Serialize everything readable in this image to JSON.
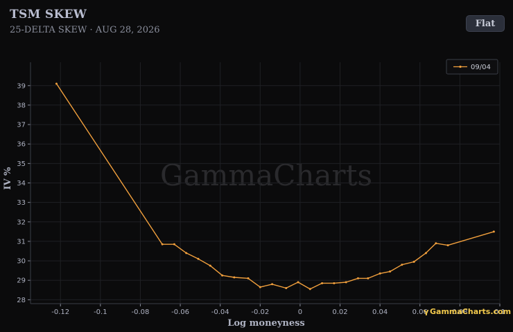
{
  "header": {
    "title": "TSM SKEW",
    "subtitle": "25-DELTA SKEW · AUG 28, 2026",
    "flat_label": "Flat"
  },
  "watermark": "GammaCharts",
  "brand": "GammaCharts.com",
  "colors": {
    "series": "#f2a03d",
    "background": "#0b0b0c",
    "grid": "#1f2024",
    "brand": "#f2c94c"
  },
  "chart_data": {
    "type": "line",
    "xlabel": "Log moneyness",
    "ylabel": "IV %",
    "xlim": [
      -0.135,
      0.1
    ],
    "ylim": [
      27.8,
      40.2
    ],
    "xticks": [
      -0.12,
      -0.1,
      -0.08,
      -0.06,
      -0.04,
      -0.02,
      0,
      0.02,
      0.04,
      0.06,
      0.08,
      0.1
    ],
    "xtick_labels": [
      "-0.12",
      "-0.1",
      "-0.08",
      "-0.06",
      "-0.04",
      "-0.02",
      "0",
      "0.02",
      "0.04",
      "0.06",
      "0.08",
      "0.1"
    ],
    "yticks": [
      28,
      29,
      30,
      31,
      32,
      33,
      34,
      35,
      36,
      37,
      38,
      39
    ],
    "grid": true,
    "legend_position": "top-right",
    "series": [
      {
        "name": "09/04",
        "color": "#f2a03d",
        "x": [
          -0.122,
          -0.069,
          -0.063,
          -0.057,
          -0.051,
          -0.045,
          -0.039,
          -0.033,
          -0.026,
          -0.02,
          -0.014,
          -0.007,
          -0.001,
          0.005,
          0.011,
          0.017,
          0.023,
          0.029,
          0.034,
          0.04,
          0.045,
          0.051,
          0.057,
          0.063,
          0.068,
          0.074,
          0.097
        ],
        "y": [
          39.1,
          30.85,
          30.85,
          30.4,
          30.1,
          29.75,
          29.25,
          29.15,
          29.1,
          28.65,
          28.8,
          28.6,
          28.9,
          28.55,
          28.85,
          28.85,
          28.9,
          29.1,
          29.1,
          29.35,
          29.45,
          29.8,
          29.95,
          30.4,
          30.9,
          30.8,
          31.5
        ]
      }
    ]
  }
}
